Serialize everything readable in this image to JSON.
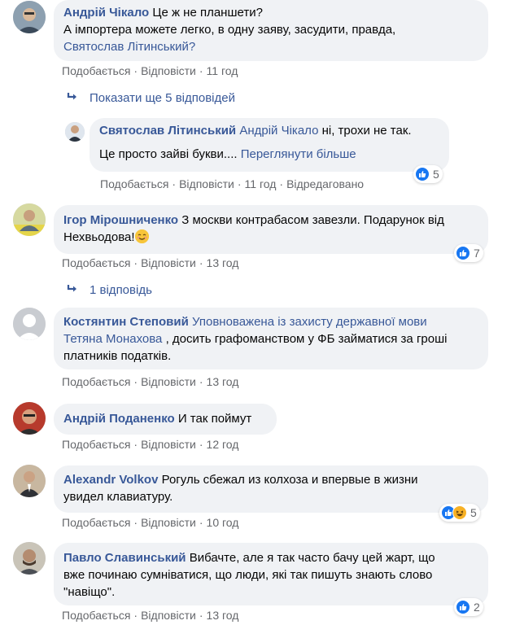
{
  "comments": [
    {
      "author": "Андрій Чікало",
      "lines": [
        "Це ж не планшети?",
        "А імпортера можете легко, в одну заяву, засудити, правда,"
      ],
      "mention_line": "Святослав Літинський?",
      "like": "Подобається",
      "reply": "Відповісти",
      "time": "11 год"
    },
    {
      "author": "Ігор Мірошниченко",
      "line1": "З москви контрабасом завезли. Подарунок від",
      "line2": "Нехвьодова!",
      "like": "Подобається",
      "reply": "Відповісти",
      "time": "13 год",
      "reactions": "7",
      "replies": "1 відповідь"
    },
    {
      "author": "Костянтин Степовий",
      "mention1": "Уповноважена із захисту державної мови",
      "mention2": "Тетяна Монахова",
      "line2": ", досить графоманством у ФБ займатися за гроші",
      "line3": "платників податків.",
      "like": "Подобається",
      "reply": "Відповісти",
      "time": "13 год"
    },
    {
      "author": "Андрій Поданенко",
      "line1": "И так поймут",
      "like": "Подобається",
      "reply": "Відповісти",
      "time": "12 год"
    },
    {
      "author": "Alexandr Volkov",
      "line1": "Рогуль сбежал из колхоза и впервые в жизни",
      "line2": "увидел клавиатуру.",
      "like": "Подобається",
      "reply": "Відповісти",
      "time": "10 год",
      "reactions": "5"
    },
    {
      "author": "Павло Славинський",
      "line1": "Вибачте, але я так часто бачу цей жарт, що",
      "line2": "вже починаю сумніватися, що люди, які так пишуть знають слово",
      "line3": "\"навіщо\".",
      "like": "Подобається",
      "reply": "Відповісти",
      "time": "13 год",
      "reactions": "2"
    }
  ],
  "more_replies": "Показати ще 5 відповідей",
  "reply_comment": {
    "author": "Святослав Літинський",
    "mention": "Андрій Чікало",
    "line1": "ні, трохи не так.",
    "line2": "Це просто зайві букви....",
    "see_more": "Переглянути більше",
    "like": "Подобається",
    "reply": "Відповісти",
    "time": "11 год",
    "edited": "Відредаговано",
    "reactions": "5"
  },
  "colors": {
    "link": "#385898",
    "bubble": "#f0f2f5",
    "meta": "#65676b",
    "like_blue": "#1877f2"
  },
  "icons": {
    "reply_arrow": "↳",
    "like": "thumbs-up-icon",
    "haha": "haha-icon",
    "smile": "smiling-face-emoji"
  }
}
